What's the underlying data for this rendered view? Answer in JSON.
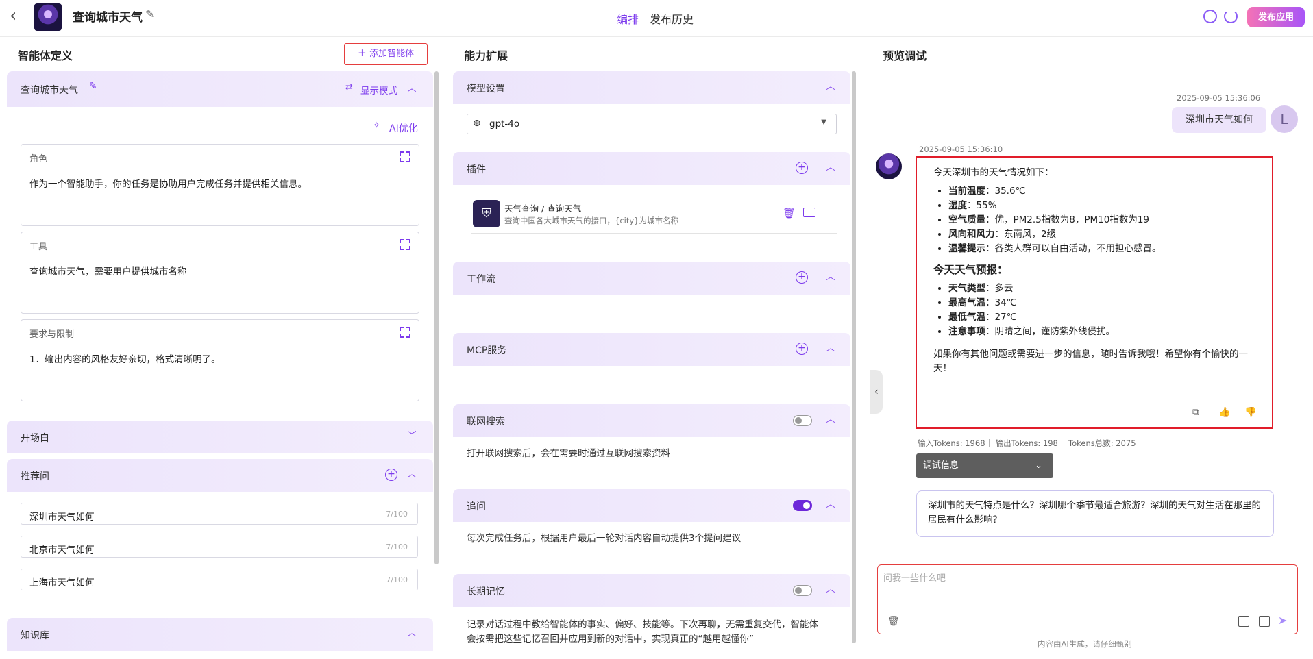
{
  "topbar": {
    "title": "查询城市天气",
    "tab_edit": "编排",
    "tab_history": "发布历史",
    "publish": "发布应用"
  },
  "left": {
    "title": "智能体定义",
    "add_agent": "添加智能体",
    "agent_name": "查询城市天气",
    "display_mode": "显示模式",
    "ai_optimize": "AI优化",
    "role": {
      "label": "角色",
      "text": "作为一个智能助手，你的任务是协助用户完成任务并提供相关信息。"
    },
    "tool": {
      "label": "工具",
      "text": "查询城市天气，需要用户提供城市名称"
    },
    "limit": {
      "label": "要求与限制",
      "text": "1．输出内容的风格友好亲切，格式清晰明了。"
    },
    "opening": "开场白",
    "recommend": "推荐问",
    "questions": [
      {
        "text": "深圳市天气如何",
        "count": "7/100"
      },
      {
        "text": "北京市天气如何",
        "count": "7/100"
      },
      {
        "text": "上海市天气如何",
        "count": "7/100"
      }
    ],
    "knowledge": "知识库"
  },
  "middle": {
    "title": "能力扩展",
    "model": {
      "label": "模型设置",
      "value": "gpt-4o"
    },
    "plugin": {
      "label": "插件",
      "name": "天气查询 / 查询天气",
      "desc": "查询中国各大城市天气的接口，{city}为城市名称"
    },
    "workflow": "工作流",
    "mcp": "MCP服务",
    "websearch": {
      "label": "联网搜索",
      "desc": "打开联网搜索后，会在需要时通过互联网搜索资料",
      "on": false
    },
    "followup": {
      "label": "追问",
      "desc": "每次完成任务后，根据用户最后一轮对话内容自动提供3个提问建议",
      "on": true
    },
    "memory": {
      "label": "长期记忆",
      "desc1": "记录对话过程中教给智能体的事实、偏好、技能等。下次再聊，无需重复交代，智能体",
      "desc2": "会按需把这些记忆召回并应用到新的对话中，实现真正的“越用越懂你”",
      "on": false
    }
  },
  "preview": {
    "title": "预览调试",
    "user_time": "2025-09-05 15:36:06",
    "user_msg": "深圳市天气如何",
    "user_initial": "L",
    "bot_time": "2025-09-05 15:36:10",
    "intro": "今天深圳市的天气情况如下：",
    "items1": [
      {
        "k": "当前温度",
        "v": "：35.6℃"
      },
      {
        "k": "湿度",
        "v": "：55%"
      },
      {
        "k": "空气质量",
        "v": "：优，PM2.5指数为8，PM10指数为19"
      },
      {
        "k": "风向和风力",
        "v": "：东南风，2级"
      },
      {
        "k": "温馨提示",
        "v": "：各类人群可以自由活动，不用担心感冒。"
      }
    ],
    "forecast_title": "今天天气预报：",
    "items2": [
      {
        "k": "天气类型",
        "v": "：多云"
      },
      {
        "k": "最高气温",
        "v": "：34℃"
      },
      {
        "k": "最低气温",
        "v": "：27℃"
      },
      {
        "k": "注意事项",
        "v": "：阴晴之间，谨防紫外线侵扰。"
      }
    ],
    "tail": "如果你有其他问题或需要进一步的信息，随时告诉我哦！希望你有个愉快的一天！",
    "tokens": "输入Tokens: 1968｜ 输出Tokens: 198｜ Tokens总数: 2075",
    "debug": "调试信息",
    "suggest": "深圳市的天气特点是什么？深圳哪个季节最适合旅游？深圳的天气对生活在那里的居民有什么影响？",
    "input_placeholder": "问我一些什么吧",
    "disclaimer": "内容由AI生成，请仔细甄别"
  }
}
